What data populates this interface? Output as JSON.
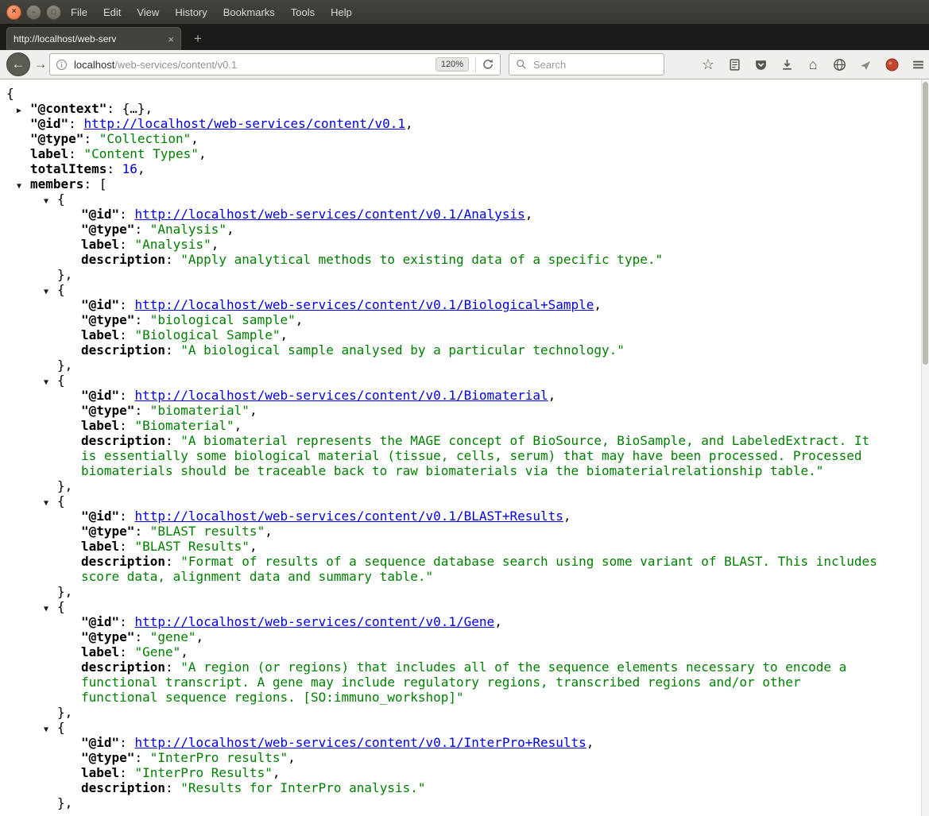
{
  "titlebar": {
    "menu": [
      "File",
      "Edit",
      "View",
      "History",
      "Bookmarks",
      "Tools",
      "Help"
    ]
  },
  "tabbar": {
    "active_tab_title": "http://localhost/web-serv"
  },
  "navbar": {
    "url_host": "localhost",
    "url_path": "/web-services/content/v0.1",
    "zoom_badge": "120%",
    "search_placeholder": "Search"
  },
  "icons": {
    "close": "×",
    "minimize": "−",
    "maximize": "□",
    "tab_close": "×",
    "new_tab": "+",
    "back": "←",
    "forward": "→",
    "star": "☆",
    "home": "⌂"
  },
  "punct": {
    "root_open": "{",
    "colon": ": ",
    "comma": ",",
    "context_value": "{…},",
    "open_brace": "{",
    "close_brace_comma": "},",
    "open_bracket": "[",
    "tri_down": "▼",
    "tri_right": "▶"
  },
  "viewer": {
    "keys": {
      "context": "\"@context\"",
      "id": "\"@id\"",
      "type": "\"@type\"",
      "label": "label",
      "total": "totalItems",
      "members": "members",
      "description": "description"
    },
    "root": {
      "id_link": "http://localhost/web-services/content/v0.1",
      "type_value": "\"Collection\"",
      "label_value": "\"Content Types\"",
      "total_value": "16"
    },
    "members": [
      {
        "id": "http://localhost/web-services/content/v0.1/Analysis",
        "type": "\"Analysis\"",
        "label": "\"Analysis\"",
        "description": "\"Apply analytical methods to existing data of a specific type.\""
      },
      {
        "id": "http://localhost/web-services/content/v0.1/Biological+Sample",
        "type": "\"biological sample\"",
        "label": "\"Biological Sample\"",
        "description": "\"A biological sample analysed by a particular technology.\""
      },
      {
        "id": "http://localhost/web-services/content/v0.1/Biomaterial",
        "type": "\"biomaterial\"",
        "label": "\"Biomaterial\"",
        "description": "\"A biomaterial represents the MAGE concept of BioSource, BioSample, and LabeledExtract. It is essentially some biological material (tissue, cells, serum) that may have been processed. Processed biomaterials should be traceable back to raw biomaterials via the biomaterialrelationship table.\""
      },
      {
        "id": "http://localhost/web-services/content/v0.1/BLAST+Results",
        "type": "\"BLAST results\"",
        "label": "\"BLAST Results\"",
        "description": "\"Format of results of a sequence database search using some variant of BLAST. This includes score data, alignment data and summary table.\""
      },
      {
        "id": "http://localhost/web-services/content/v0.1/Gene",
        "type": "\"gene\"",
        "label": "\"Gene\"",
        "description": "\"A region (or regions) that includes all of the sequence elements necessary to encode a functional transcript. A gene may include regulatory regions, transcribed regions and/or other functional sequence regions. [SO:immuno_workshop]\""
      },
      {
        "id": "http://localhost/web-services/content/v0.1/InterPro+Results",
        "type": "\"InterPro results\"",
        "label": "\"InterPro Results\"",
        "description": "\"Results for InterPro analysis.\""
      }
    ]
  },
  "colors": {
    "key": "#000000",
    "string": "#008000",
    "link": "#0000ee",
    "number": "#0000cc"
  }
}
